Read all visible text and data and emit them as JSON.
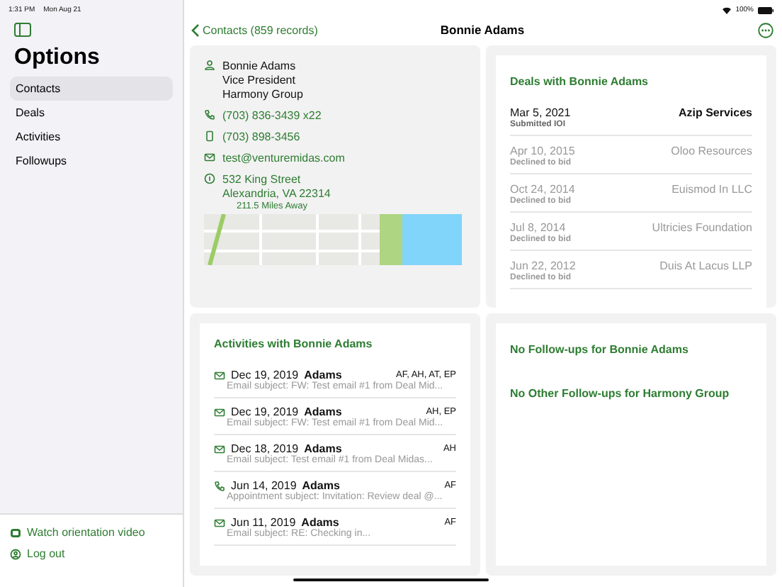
{
  "status_bar": {
    "time": "1:31 PM",
    "date": "Mon Aug 21",
    "battery": "100%"
  },
  "sidebar": {
    "title": "Options",
    "items": [
      {
        "label": "Contacts",
        "selected": true
      },
      {
        "label": "Deals",
        "selected": false
      },
      {
        "label": "Activities",
        "selected": false
      },
      {
        "label": "Followups",
        "selected": false
      }
    ],
    "footer": [
      {
        "kind": "video",
        "label": "Watch orientation video"
      },
      {
        "kind": "logout",
        "label": "Log out"
      }
    ]
  },
  "nav": {
    "back": "Contacts (859 records)",
    "title": "Bonnie Adams"
  },
  "contact": {
    "name": "Bonnie Adams",
    "role": "Vice President",
    "company": "Harmony Group",
    "phone": "(703) 836-3439 x22",
    "mobile": "(703) 898-3456",
    "email": "test@venturemidas.com",
    "street": "532 King Street",
    "city": "Alexandria, VA  22314",
    "distance": "211.5 Miles Away"
  },
  "deals": {
    "title": "Deals with Bonnie Adams",
    "rows": [
      {
        "date": "Mar 5, 2021",
        "status": "Submitted IOI",
        "company": "Azip Services",
        "active": true
      },
      {
        "date": "Apr 10, 2015",
        "status": "Declined to bid",
        "company": "Oloo Resources",
        "active": false
      },
      {
        "date": "Oct 24, 2014",
        "status": "Declined to bid",
        "company": "Euismod In LLC",
        "active": false
      },
      {
        "date": "Jul 8, 2014",
        "status": "Declined to bid",
        "company": "Ultricies Foundation",
        "active": false
      },
      {
        "date": "Jun 22, 2012",
        "status": "Declined to bid",
        "company": "Duis At Lacus LLP",
        "active": false
      }
    ]
  },
  "activities": {
    "title": "Activities with Bonnie Adams",
    "rows": [
      {
        "kind": "email",
        "date": "Dec 19, 2019",
        "name": "Adams",
        "initials": "AF, AH, AT, EP",
        "subject": "Email subject: FW: Test email #1 from Deal Mid..."
      },
      {
        "kind": "email",
        "date": "Dec 19, 2019",
        "name": "Adams",
        "initials": "AH, EP",
        "subject": "Email subject: FW: Test email #1 from Deal Mid..."
      },
      {
        "kind": "email",
        "date": "Dec 18, 2019",
        "name": "Adams",
        "initials": "AH",
        "subject": "Email subject: Test email #1 from Deal Midas..."
      },
      {
        "kind": "call",
        "date": "Jun 14, 2019",
        "name": "Adams",
        "initials": "AF",
        "subject": "Appointment subject: Invitation: Review deal @..."
      },
      {
        "kind": "email",
        "date": "Jun 11, 2019",
        "name": "Adams",
        "initials": "AF",
        "subject": "Email subject: RE: Checking in..."
      }
    ]
  },
  "followups": [
    "No Follow-ups for Bonnie Adams",
    "No Other Follow-ups for Harmony Group"
  ]
}
